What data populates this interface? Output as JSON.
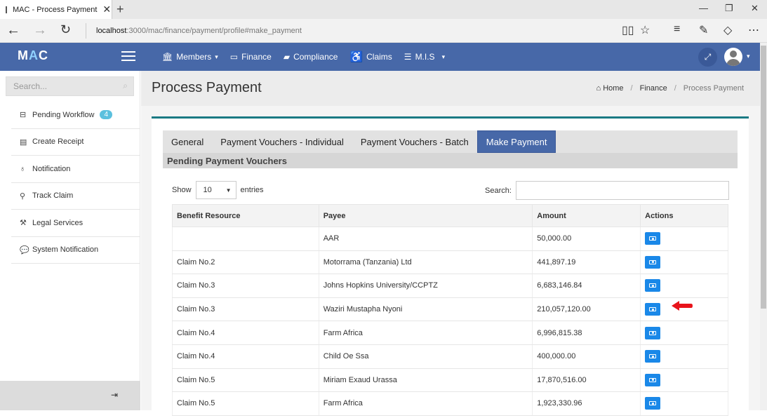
{
  "browser": {
    "tab_title": "MAC - Process Payment",
    "url_host": "localhost",
    "url_path": ":3000/mac/finance/payment/profile#make_payment"
  },
  "app": {
    "logo_m": "M",
    "logo_a": "A",
    "logo_c": "C",
    "menu": [
      {
        "label": "Members",
        "icon": "members-icon",
        "has_caret": true
      },
      {
        "label": "Finance",
        "icon": "finance-icon",
        "has_caret": false
      },
      {
        "label": "Compliance",
        "icon": "compliance-icon",
        "has_caret": false
      },
      {
        "label": "Claims",
        "icon": "wheelchair-icon",
        "has_caret": false
      },
      {
        "label": "M.I.S",
        "icon": "list-icon",
        "has_caret": true
      }
    ]
  },
  "sidebar": {
    "search_placeholder": "Search...",
    "items": [
      {
        "label": "Pending Workflow",
        "badge": "4",
        "icon": "inbox-icon"
      },
      {
        "label": "Create Receipt",
        "icon": "receipt-icon"
      },
      {
        "label": "Notification",
        "icon": "bell-icon"
      },
      {
        "label": "Track Claim",
        "icon": "track-icon"
      },
      {
        "label": "Legal Services",
        "icon": "gavel-icon"
      },
      {
        "label": "System Notification",
        "icon": "chat-icon"
      }
    ]
  },
  "page": {
    "title": "Process Payment",
    "breadcrumb": [
      "Home",
      "Finance",
      "Process Payment"
    ]
  },
  "tabs": [
    {
      "label": "General",
      "active": false
    },
    {
      "label": "Payment Vouchers - Individual",
      "active": false
    },
    {
      "label": "Payment Vouchers - Batch",
      "active": false
    },
    {
      "label": "Make Payment",
      "active": true
    }
  ],
  "section_title": "Pending Payment Vouchers",
  "table_controls": {
    "show_label": "Show",
    "entries_value": "10",
    "entries_label": "entries",
    "search_label": "Search:"
  },
  "table": {
    "columns": [
      "Benefit Resource",
      "Payee",
      "Amount",
      "Actions"
    ],
    "rows": [
      {
        "benefit": "",
        "payee": "AAR",
        "amount": "50,000.00"
      },
      {
        "benefit": "Claim No.2",
        "payee": "Motorrama (Tanzania) Ltd",
        "amount": "441,897.19"
      },
      {
        "benefit": "Claim No.3",
        "payee": "Johns Hopkins University/CCPTZ",
        "amount": "6,683,146.84"
      },
      {
        "benefit": "Claim No.3",
        "payee": "Waziri Mustapha Nyoni",
        "amount": "210,057,120.00"
      },
      {
        "benefit": "Claim No.4",
        "payee": "Farm Africa",
        "amount": "6,996,815.38"
      },
      {
        "benefit": "Claim No.4",
        "payee": "Child Oe Ssa",
        "amount": "400,000.00"
      },
      {
        "benefit": "Claim No.5",
        "payee": "Miriam Exaud Urassa",
        "amount": "17,870,516.00"
      },
      {
        "benefit": "Claim No.5",
        "payee": "Farm Africa",
        "amount": "1,923,330.96"
      }
    ]
  },
  "colors": {
    "header_blue": "#4768a8",
    "action_blue": "#1a88e8",
    "card_accent": "#1a7a83",
    "badge": "#5bc0de",
    "arrow": "#e8141b"
  }
}
